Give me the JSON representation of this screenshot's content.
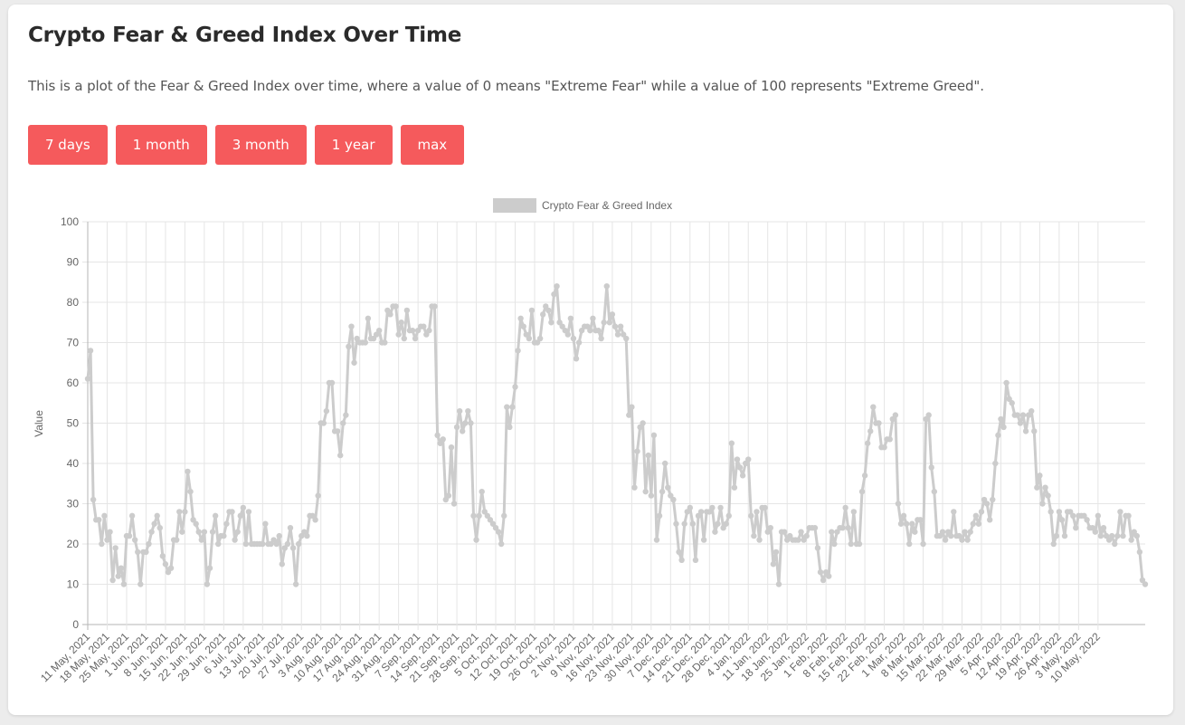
{
  "page": {
    "title": "Crypto Fear & Greed Index Over Time",
    "description": "This is a plot of the Fear & Greed Index over time, where a value of 0 means \"Extreme Fear\" while a value of 100 represents \"Extreme Greed\".",
    "buttons": [
      {
        "label": "7 days"
      },
      {
        "label": "1 month"
      },
      {
        "label": "3 month"
      },
      {
        "label": "1 year"
      },
      {
        "label": "max"
      }
    ],
    "colors": {
      "accent": "#f55a5c",
      "series": "#cccccc",
      "grid": "#e5e5e5",
      "axis": "#b5b5b5"
    }
  },
  "chart_data": {
    "type": "line",
    "title": "",
    "xlabel": "",
    "ylabel": "Value",
    "ylim": [
      0,
      100
    ],
    "yticks": [
      0,
      10,
      20,
      30,
      40,
      50,
      60,
      70,
      80,
      90,
      100
    ],
    "grid": true,
    "legend": {
      "position": "top",
      "entries": [
        "Crypto Fear & Greed Index"
      ]
    },
    "start_date": "11 May, 2021",
    "end_date": "10 May, 2022",
    "xticks": [
      "11 May, 2021",
      "18 May, 2021",
      "25 May, 2021",
      "1 Jun, 2021",
      "8 Jun, 2021",
      "15 Jun, 2021",
      "22 Jun, 2021",
      "29 Jun, 2021",
      "6 Jul, 2021",
      "13 Jul, 2021",
      "20 Jul, 2021",
      "27 Jul, 2021",
      "3 Aug, 2021",
      "10 Aug, 2021",
      "17 Aug, 2021",
      "24 Aug, 2021",
      "31 Aug, 2021",
      "7 Sep, 2021",
      "14 Sep, 2021",
      "21 Sep, 2021",
      "28 Sep, 2021",
      "5 Oct, 2021",
      "12 Oct, 2021",
      "19 Oct, 2021",
      "26 Oct, 2021",
      "2 Nov, 2021",
      "9 Nov, 2021",
      "16 Nov, 2021",
      "23 Nov, 2021",
      "30 Nov, 2021",
      "7 Dec, 2021",
      "14 Dec, 2021",
      "21 Dec, 2021",
      "28 Dec, 2021",
      "4 Jan, 2022",
      "11 Jan, 2022",
      "18 Jan, 2022",
      "25 Jan, 2022",
      "1 Feb, 2022",
      "8 Feb, 2022",
      "15 Feb, 2022",
      "22 Feb, 2022",
      "1 Mar, 2022",
      "8 Mar, 2022",
      "15 Mar, 2022",
      "22 Mar, 2022",
      "29 Mar, 2022",
      "5 Apr, 2022",
      "12 Apr, 2022",
      "19 Apr, 2022",
      "26 Apr, 2022",
      "3 May, 2022",
      "10 May, 2022"
    ],
    "series": [
      {
        "name": "Crypto Fear & Greed Index",
        "values": [
          61,
          68,
          31,
          26,
          26,
          20,
          27,
          21,
          23,
          11,
          19,
          12,
          14,
          10,
          22,
          22,
          27,
          21,
          18,
          10,
          18,
          18,
          20,
          23,
          25,
          27,
          24,
          17,
          15,
          13,
          14,
          21,
          21,
          28,
          23,
          28,
          38,
          33,
          26,
          25,
          23,
          21,
          23,
          10,
          14,
          23,
          27,
          20,
          22,
          22,
          25,
          28,
          28,
          21,
          23,
          27,
          29,
          20,
          28,
          20,
          20,
          20,
          20,
          20,
          25,
          20,
          20,
          21,
          20,
          22,
          15,
          19,
          20,
          24,
          19,
          10,
          20,
          22,
          23,
          22,
          27,
          27,
          26,
          32,
          50,
          50,
          53,
          60,
          60,
          48,
          48,
          42,
          50,
          52,
          69,
          74,
          65,
          71,
          70,
          70,
          70,
          76,
          71,
          71,
          72,
          73,
          70,
          70,
          78,
          77,
          79,
          79,
          72,
          75,
          71,
          78,
          73,
          73,
          71,
          73,
          74,
          74,
          72,
          73,
          79,
          79,
          47,
          45,
          46,
          31,
          32,
          44,
          30,
          49,
          53,
          48,
          50,
          53,
          50,
          27,
          21,
          27,
          33,
          28,
          27,
          26,
          25,
          24,
          23,
          20,
          27,
          54,
          49,
          54,
          59,
          68,
          76,
          74,
          72,
          71,
          78,
          70,
          70,
          71,
          77,
          79,
          78,
          75,
          82,
          84,
          75,
          74,
          73,
          72,
          76,
          71,
          66,
          70,
          73,
          74,
          74,
          73,
          76,
          73,
          73,
          71,
          75,
          84,
          75,
          77,
          74,
          72,
          74,
          72,
          71,
          52,
          54,
          34,
          43,
          49,
          50,
          33,
          42,
          32,
          47,
          21,
          27,
          33,
          40,
          34,
          32,
          31,
          25,
          18,
          16,
          25,
          28,
          29,
          25,
          16,
          27,
          28,
          21,
          28,
          28,
          29,
          23,
          25,
          29,
          24,
          25,
          27,
          45,
          34,
          41,
          39,
          37,
          40,
          41,
          27,
          22,
          28,
          21,
          29,
          29,
          23,
          24,
          15,
          18,
          10,
          23,
          23,
          21,
          22,
          21,
          21,
          21,
          23,
          21,
          22,
          24,
          24,
          24,
          19,
          13,
          11,
          13,
          12,
          23,
          20,
          23,
          24,
          24,
          29,
          24,
          20,
          28,
          20,
          20,
          33,
          37,
          45,
          48,
          54,
          50,
          50,
          44,
          44,
          46,
          46,
          51,
          52,
          30,
          25,
          27,
          25,
          20,
          25,
          23,
          26,
          26,
          20,
          51,
          52,
          39,
          33,
          22,
          22,
          23,
          21,
          23,
          22,
          28,
          22,
          22,
          21,
          23,
          21,
          23,
          25,
          27,
          25,
          28,
          31,
          30,
          26,
          31,
          40,
          47,
          51,
          49,
          60,
          56,
          55,
          52,
          52,
          50,
          52,
          48,
          52,
          53,
          48,
          34,
          37,
          30,
          34,
          32,
          28,
          20,
          22,
          28,
          26,
          22,
          28,
          28,
          27,
          24,
          27,
          27,
          27,
          26,
          24,
          24,
          23,
          27,
          22,
          24,
          22,
          21,
          22,
          20,
          22,
          28,
          22,
          27,
          27,
          21,
          23,
          22,
          18,
          11,
          10
        ]
      }
    ]
  }
}
